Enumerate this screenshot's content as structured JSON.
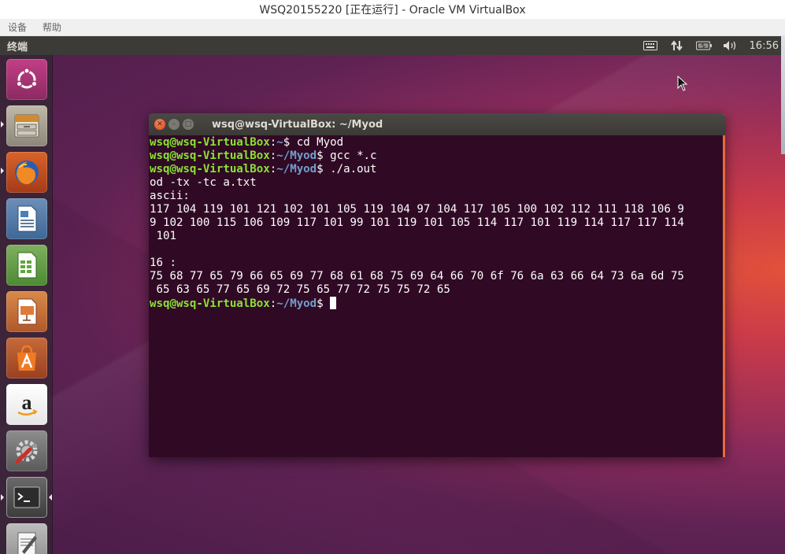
{
  "host": {
    "title": "WSQ20155220 [正在运行] - Oracle VM VirtualBox",
    "menu": [
      "设备",
      "帮助"
    ]
  },
  "panel": {
    "app_title": "终端",
    "clock": "16:56",
    "indicator_icons": [
      "keyboard-icon",
      "network-icon",
      "battery-icon",
      "volume-icon"
    ]
  },
  "launcher": {
    "items": [
      {
        "name": "dash-icon"
      },
      {
        "name": "files-icon"
      },
      {
        "name": "firefox-icon"
      },
      {
        "name": "writer-icon"
      },
      {
        "name": "calc-icon"
      },
      {
        "name": "impress-icon"
      },
      {
        "name": "software-center-icon"
      },
      {
        "name": "amazon-icon"
      },
      {
        "name": "settings-icon"
      },
      {
        "name": "terminal-icon"
      },
      {
        "name": "text-editor-icon"
      }
    ]
  },
  "terminal": {
    "title": "wsq@wsq-VirtualBox: ~/Myod",
    "prompt_user_host": "wsq@wsq-VirtualBox",
    "lines": [
      {
        "type": "prompt",
        "path": "~",
        "cmd": " cd Myod"
      },
      {
        "type": "prompt",
        "path": "~/Myod",
        "cmd": " gcc *.c"
      },
      {
        "type": "prompt",
        "path": "~/Myod",
        "cmd": " ./a.out"
      },
      {
        "type": "text",
        "text": "od -tx -tc a.txt"
      },
      {
        "type": "text",
        "text": "ascii:"
      },
      {
        "type": "text",
        "text": "117 104 119 101 121 102 101 105 119 104 97 104 117 105 100 102 112 111 118 106 9"
      },
      {
        "type": "text",
        "text": "9 102 100 115 106 109 117 101 99 101 119 101 105 114 117 101 119 114 117 117 114"
      },
      {
        "type": "text",
        "text": " 101"
      },
      {
        "type": "text",
        "text": ""
      },
      {
        "type": "text",
        "text": "16 :"
      },
      {
        "type": "text",
        "text": "75 68 77 65 79 66 65 69 77 68 61 68 75 69 64 66 70 6f 76 6a 63 66 64 73 6a 6d 75"
      },
      {
        "type": "text",
        "text": " 65 63 65 77 65 69 72 75 65 77 72 75 75 72 65"
      },
      {
        "type": "prompt",
        "path": "~/Myod",
        "cmd": " ",
        "cursor": true
      }
    ]
  }
}
